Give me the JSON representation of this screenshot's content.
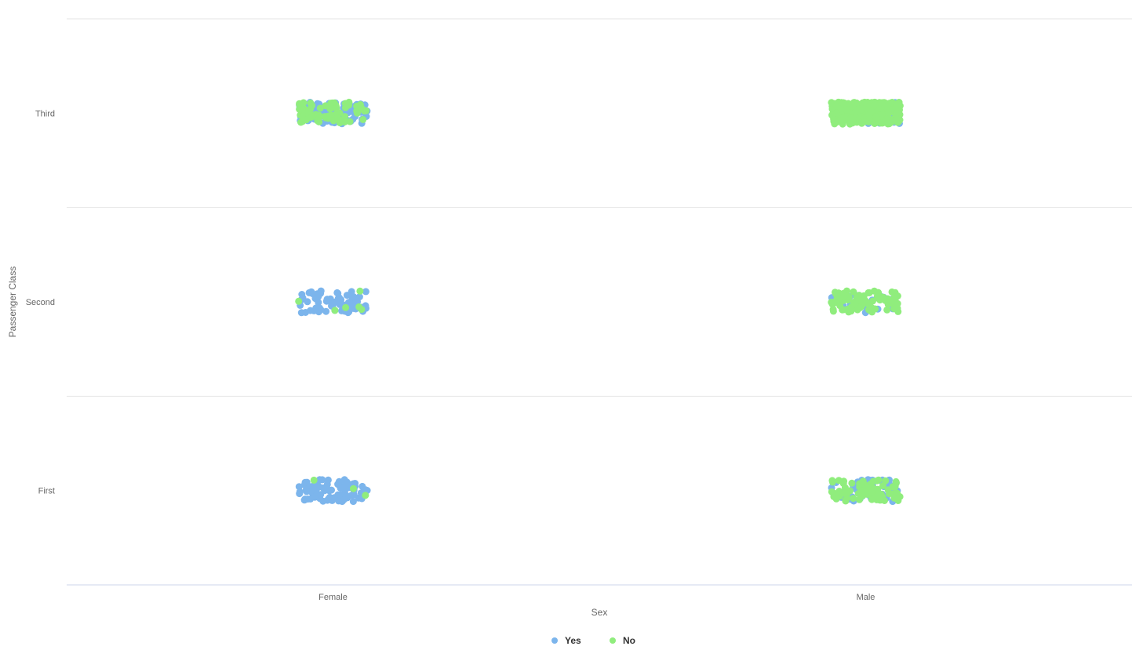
{
  "chart_data": {
    "type": "scatter",
    "title": "",
    "xlabel": "Sex",
    "ylabel": "Passenger Class",
    "x_categories": [
      "Female",
      "Male"
    ],
    "y_categories": [
      "First",
      "Second",
      "Third"
    ],
    "grid": true,
    "legend_position": "bottom-center",
    "jitter": true,
    "series": [
      {
        "name": "Yes",
        "color": "#7cb5ec",
        "groups": [
          {
            "x": "Female",
            "y": "First",
            "count": 91
          },
          {
            "x": "Female",
            "y": "Second",
            "count": 70
          },
          {
            "x": "Female",
            "y": "Third",
            "count": 72
          },
          {
            "x": "Male",
            "y": "First",
            "count": 45
          },
          {
            "x": "Male",
            "y": "Second",
            "count": 17
          },
          {
            "x": "Male",
            "y": "Third",
            "count": 47
          }
        ]
      },
      {
        "name": "No",
        "color": "#90ed7d",
        "groups": [
          {
            "x": "Female",
            "y": "First",
            "count": 3
          },
          {
            "x": "Female",
            "y": "Second",
            "count": 6
          },
          {
            "x": "Female",
            "y": "Third",
            "count": 72
          },
          {
            "x": "Male",
            "y": "First",
            "count": 77
          },
          {
            "x": "Male",
            "y": "Second",
            "count": 91
          },
          {
            "x": "Male",
            "y": "Third",
            "count": 300
          }
        ]
      }
    ]
  }
}
